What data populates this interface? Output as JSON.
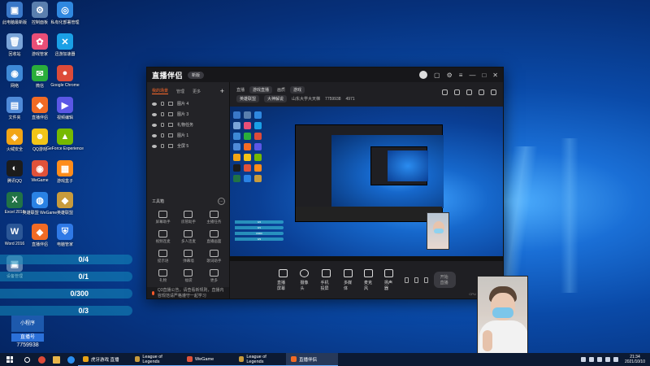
{
  "desktop": {
    "icons": [
      {
        "label": "此电脑最新版",
        "color": "#3a78c8"
      },
      {
        "label": "控制面板",
        "color": "#5a7fae"
      },
      {
        "label": "私有化部署管理",
        "color": "#2f88e0"
      },
      {
        "label": "回收站",
        "color": "#7aa4d8"
      },
      {
        "label": "游戏管家",
        "color": "#e94e77"
      },
      {
        "label": "迅游加速器",
        "color": "#1aa0e6"
      },
      {
        "label": "网络",
        "color": "#3e89d6"
      },
      {
        "label": "微信",
        "color": "#2aae3b"
      },
      {
        "label": "Google Chrome",
        "color": "#dd4b39"
      },
      {
        "label": "文件夹",
        "color": "#4f8ad8"
      },
      {
        "label": "直播伴侣",
        "color": "#f26b25"
      },
      {
        "label": "视频编辑",
        "color": "#5b57e6"
      },
      {
        "label": "火绒安全",
        "color": "#f2a515"
      },
      {
        "label": "QQ游戏",
        "color": "#f2c518"
      },
      {
        "label": "GeForce Experience",
        "color": "#76b900"
      },
      {
        "label": "腾讯QQ",
        "color": "#1c1c1c"
      },
      {
        "label": "WeGame",
        "color": "#e0523a"
      },
      {
        "label": "游戏盒子",
        "color": "#ff8c1a"
      },
      {
        "label": "Excel 2016",
        "color": "#217346"
      },
      {
        "label": "英雄联盟 WeGame",
        "color": "#2a82e4"
      },
      {
        "label": "英雄联盟",
        "color": "#c89b3c"
      },
      {
        "label": "Word 2016",
        "color": "#2b5797"
      },
      {
        "label": "直播伴侣",
        "color": "#f26b25"
      },
      {
        "label": "电脑管家",
        "color": "#2f79e6"
      },
      {
        "label": "设备管理",
        "color": "#5a7fae"
      }
    ],
    "progress": [
      {
        "label": "0/4",
        "fraction": 0.0
      },
      {
        "label": "0/1",
        "fraction": 0.0
      },
      {
        "label": "0/300",
        "fraction": 0.0
      },
      {
        "label": "0/3",
        "fraction": 0.0
      }
    ],
    "bottom_left": {
      "mini_label": "小程序",
      "name": "直播号",
      "id": "7759938"
    }
  },
  "app": {
    "logo": "直播伴侣",
    "version_badge": "新版",
    "sidebar": {
      "tabs": [
        "我的场景",
        "管理",
        "更多"
      ],
      "active_tab": "我的场景",
      "scenes": [
        "图片 4",
        "图片 3",
        "礼物任务",
        "图片 1",
        "全屏 5"
      ],
      "toolbox_title": "工具箱",
      "tools": [
        "屏幕助手",
        "房管助手",
        "主播任务",
        "视频连麦",
        "多人连麦",
        "直播画面",
        "提示语",
        "弹幕墙",
        "歌词助手",
        "礼物",
        "福袋",
        "更多"
      ]
    },
    "infobar": {
      "row1": [
        "直播",
        "游戏直播",
        "画质",
        "游戏"
      ],
      "row2": [
        "英雄联盟",
        "大神解说",
        "山东大学大天梯",
        "7759938",
        "4971"
      ]
    },
    "controls": [
      "直播屏幕",
      "摄像头",
      "手机投屏",
      "多媒体",
      "麦克风",
      "扬声器"
    ],
    "go_live": "开始直播",
    "notice": "Q3直播公告，请查看新规则，直播内容规范请严格遵守一起学习",
    "status": "CPU 12%  内存 6%"
  },
  "taskbar": {
    "tasks": [
      {
        "label": "虎牙游戏 直播",
        "color": "#e8a316",
        "active": false
      },
      {
        "label": "League of Legends",
        "color": "#c89b3c",
        "active": false
      },
      {
        "label": "WeGame",
        "color": "#e0523a",
        "active": false
      },
      {
        "label": "League of Legends",
        "color": "#c89b3c",
        "active": false
      },
      {
        "label": "直播伴侣",
        "color": "#f26b25",
        "active": true
      }
    ],
    "time": "21:34",
    "date": "2021/10/10"
  }
}
